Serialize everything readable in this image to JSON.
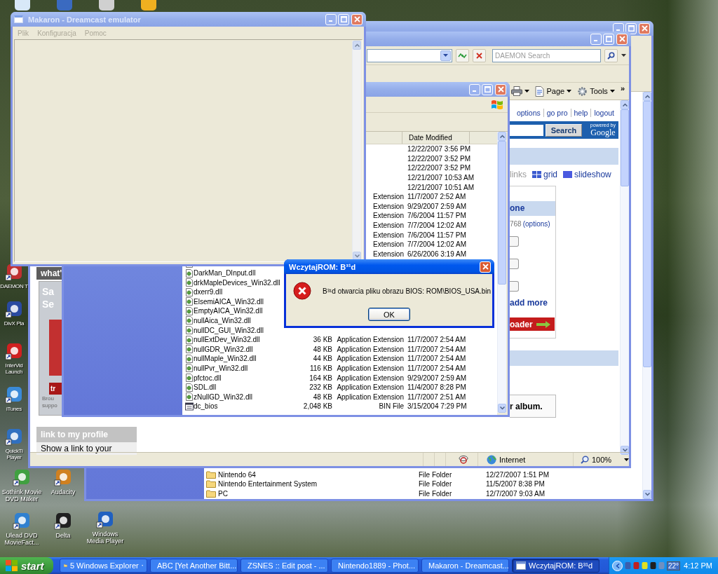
{
  "desktop_icons": [
    {
      "label": "DAEMON T"
    },
    {
      "label": "DivX Pla"
    },
    {
      "label": "InterVid Launch"
    },
    {
      "label": "iTunes"
    },
    {
      "label": "QuickTi Player"
    },
    {
      "label": "Sothink Movie DVD Maker"
    },
    {
      "label": "Audacity"
    },
    {
      "label": "Ulead DVD MovieFact..."
    },
    {
      "label": "Delta"
    },
    {
      "label": "Windows Media Player"
    }
  ],
  "explorer_back": {
    "rows": [
      {
        "name": "Nintendo 64",
        "type": "File Folder",
        "date": "12/27/2007 1:51 PM"
      },
      {
        "name": "Nintendo Entertainment System",
        "type": "File Folder",
        "date": "11/5/2007 8:38 PM"
      },
      {
        "name": "PC",
        "type": "File Folder",
        "date": "12/7/2007 9:03 AM"
      }
    ]
  },
  "browser": {
    "search_placeholder": "DAEMON Search",
    "command_bar": [
      {
        "label": "Page",
        "kind": "page"
      },
      {
        "label": "Tools",
        "kind": "tools"
      }
    ],
    "chevron": "»",
    "top_links": [
      "options",
      "go pro",
      "help",
      "logout"
    ],
    "search_button": "Search",
    "powered_by": "powered by",
    "google": "Google",
    "view_links": [
      {
        "label": "links",
        "kind": "text"
      },
      {
        "label": "grid",
        "kind": "grid"
      },
      {
        "label": "slideshow",
        "kind": "slideshow"
      }
    ],
    "album_tab": "one",
    "photo_count": "768",
    "options_link": "(options)",
    "add_more": "add more",
    "uploader_banner": "oader",
    "album_note": "r album.",
    "side_header": "what'",
    "promo_lines": [
      "Sa",
      "Se"
    ],
    "promo_button": "tr",
    "promo_caption": [
      "Brou",
      "suppo"
    ],
    "profile_header": "link to my profile",
    "profile_text": "Show a link to your",
    "status_zone": "Internet",
    "status_zoom": "100%"
  },
  "explorer_front": {
    "columns": [
      "Date Modified"
    ],
    "rows": [
      {
        "date": "12/22/2007 3:56 PM"
      },
      {
        "date": "12/22/2007 3:52 PM"
      },
      {
        "date": "12/22/2007 3:52 PM"
      },
      {
        "date": "12/21/2007 10:53 AM"
      },
      {
        "date": "12/21/2007 10:51 AM"
      },
      {
        "type": "Extension",
        "date": "11/7/2007 2:52 AM"
      },
      {
        "type": "Extension",
        "date": "9/29/2007 2:59 AM"
      },
      {
        "type": "Extension",
        "date": "7/6/2004 11:57 PM"
      },
      {
        "type": "Extension",
        "date": "7/7/2004 12:02 AM"
      },
      {
        "type": "Extension",
        "date": "7/6/2004 11:57 PM"
      },
      {
        "type": "Extension",
        "date": "7/7/2004 12:02 AM"
      },
      {
        "type": "Extension",
        "date": "6/26/2006 3:19 AM"
      },
      {
        "kind": "dll"
      },
      {
        "kind": "dll",
        "name": "DarkMan_DInput.dll"
      },
      {
        "kind": "dll",
        "name": "drkMapleDevices_Win32.dll"
      },
      {
        "kind": "dll",
        "name": "dxerr9.dll"
      },
      {
        "kind": "dll",
        "name": "ElsemiAICA_Win32.dll"
      },
      {
        "kind": "dll",
        "name": "EmptyAICA_Win32.dll"
      },
      {
        "kind": "dll",
        "name": "nullAica_Win32.dll"
      },
      {
        "kind": "dll",
        "name": "nullDC_GUI_Win32.dll"
      },
      {
        "kind": "dll",
        "name": "nullExtDev_Win32.dll",
        "size": "36 KB",
        "type": "Application Extension",
        "date": "11/7/2007 2:54 AM"
      },
      {
        "kind": "dll",
        "name": "nullGDR_Win32.dll",
        "size": "48 KB",
        "type": "Application Extension",
        "date": "11/7/2007 2:54 AM"
      },
      {
        "kind": "dll",
        "name": "nullMaple_Win32.dll",
        "size": "44 KB",
        "type": "Application Extension",
        "date": "11/7/2007 2:54 AM"
      },
      {
        "kind": "dll",
        "name": "nullPvr_Win32.dll",
        "size": "116 KB",
        "type": "Application Extension",
        "date": "11/7/2007 2:54 AM"
      },
      {
        "kind": "dll",
        "name": "pfctoc.dll",
        "size": "164 KB",
        "type": "Application Extension",
        "date": "9/29/2007 2:59 AM"
      },
      {
        "kind": "dll",
        "name": "SDL.dll",
        "size": "232 KB",
        "type": "Application Extension",
        "date": "11/4/2007 8:28 PM"
      },
      {
        "kind": "dll",
        "name": "zNullGD_Win32.dll",
        "size": "48 KB",
        "type": "Application Extension",
        "date": "11/7/2007 2:51 AM"
      },
      {
        "kind": "bin",
        "name": "dc_bios",
        "size": "2,048 KB",
        "type": "BIN File",
        "date": "3/15/2004 7:29 PM"
      }
    ]
  },
  "makaron": {
    "title": "Makaron - Dreamcast emulator",
    "menu": [
      {
        "label": "Plik",
        "disabled": true
      },
      {
        "label": "Konfiguracja",
        "disabled": true
      },
      {
        "label": "Pomoc",
        "disabled": true
      }
    ]
  },
  "dialog": {
    "title": "WczytajROM: B³¹d",
    "message": "B³¹d otwarcia pliku obrazu BIOS: ROM\\BIOS_USA.bin",
    "button": "OK"
  },
  "taskbar": {
    "start": "start",
    "tasks": [
      {
        "label": "5 Windows Explorer",
        "kind": "folder",
        "selected": false
      },
      {
        "label": "ABC [Yet Another Bitt...",
        "kind": "app",
        "selected": false
      },
      {
        "label": "ZSNES :: Edit post - ...",
        "kind": "browser",
        "selected": false
      },
      {
        "label": "Nintendo1889 - Phot...",
        "kind": "browser",
        "selected": false
      },
      {
        "label": "Makaron - Dreamcast...",
        "kind": "window",
        "selected": false
      },
      {
        "label": "WczytajROM: B³¹d",
        "kind": "window",
        "selected": true
      }
    ],
    "temperature": "22°",
    "clock": "4:12 PM"
  }
}
